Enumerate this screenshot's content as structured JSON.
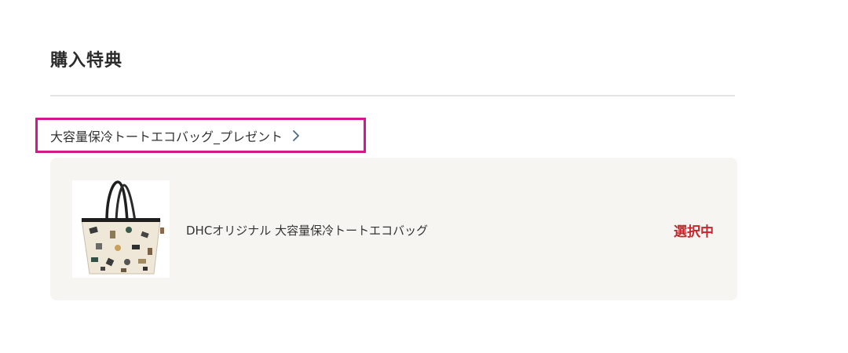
{
  "section": {
    "title": "購入特典"
  },
  "campaign": {
    "link_label": "大容量保冷トートエコバッグ_プレゼント",
    "link_icon": "chevron-right-icon",
    "highlight_color": "#d4188c"
  },
  "gift_item": {
    "name": "DHCオリジナル 大容量保冷トートエコバッグ",
    "status": "選択中",
    "status_color": "#c9252b",
    "image": "tote-bag-product-image"
  }
}
